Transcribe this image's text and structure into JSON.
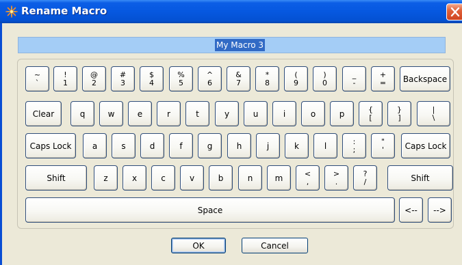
{
  "window": {
    "title": "Rename Macro",
    "icon": "asterisk-sparkle-icon",
    "close_icon": "close-x-icon"
  },
  "name_field": {
    "value": "My Macro 3"
  },
  "keyboard": {
    "rows": [
      [
        {
          "id": "tilde",
          "top": "~",
          "bottom": "`"
        },
        {
          "id": "1",
          "top": "!",
          "bottom": "1"
        },
        {
          "id": "2",
          "top": "@",
          "bottom": "2"
        },
        {
          "id": "3",
          "top": "#",
          "bottom": "3"
        },
        {
          "id": "4",
          "top": "$",
          "bottom": "4"
        },
        {
          "id": "5",
          "top": "%",
          "bottom": "5"
        },
        {
          "id": "6",
          "top": "^",
          "bottom": "6"
        },
        {
          "id": "7",
          "top": "&",
          "bottom": "7"
        },
        {
          "id": "8",
          "top": "*",
          "bottom": "8"
        },
        {
          "id": "9",
          "top": "(",
          "bottom": "9"
        },
        {
          "id": "0",
          "top": ")",
          "bottom": "0"
        },
        {
          "id": "minus",
          "top": "_",
          "bottom": "-"
        },
        {
          "id": "equals",
          "top": "+",
          "bottom": "="
        },
        {
          "id": "backspace",
          "label": "Backspace"
        }
      ],
      [
        {
          "id": "clear",
          "label": "Clear"
        },
        {
          "id": "q",
          "label": "q"
        },
        {
          "id": "w",
          "label": "w"
        },
        {
          "id": "e",
          "label": "e"
        },
        {
          "id": "r",
          "label": "r"
        },
        {
          "id": "t",
          "label": "t"
        },
        {
          "id": "y",
          "label": "y"
        },
        {
          "id": "u",
          "label": "u"
        },
        {
          "id": "i",
          "label": "i"
        },
        {
          "id": "o",
          "label": "o"
        },
        {
          "id": "p",
          "label": "p"
        },
        {
          "id": "lbracket",
          "top": "{",
          "bottom": "["
        },
        {
          "id": "rbracket",
          "top": "}",
          "bottom": "]"
        },
        {
          "id": "backslash",
          "top": "|",
          "bottom": "\\"
        }
      ],
      [
        {
          "id": "capslock-left",
          "label": "Caps Lock"
        },
        {
          "id": "a",
          "label": "a"
        },
        {
          "id": "s",
          "label": "s"
        },
        {
          "id": "d",
          "label": "d"
        },
        {
          "id": "f",
          "label": "f"
        },
        {
          "id": "g",
          "label": "g"
        },
        {
          "id": "h",
          "label": "h"
        },
        {
          "id": "j",
          "label": "j"
        },
        {
          "id": "k",
          "label": "k"
        },
        {
          "id": "l",
          "label": "l"
        },
        {
          "id": "semicolon",
          "top": ":",
          "bottom": ";"
        },
        {
          "id": "quote",
          "top": "\"",
          "bottom": "'"
        },
        {
          "id": "capslock-right",
          "label": "Caps Lock"
        }
      ],
      [
        {
          "id": "shift-left",
          "label": "Shift"
        },
        {
          "id": "z",
          "label": "z"
        },
        {
          "id": "x",
          "label": "x"
        },
        {
          "id": "c",
          "label": "c"
        },
        {
          "id": "v",
          "label": "v"
        },
        {
          "id": "b",
          "label": "b"
        },
        {
          "id": "n",
          "label": "n"
        },
        {
          "id": "m",
          "label": "m"
        },
        {
          "id": "comma",
          "top": "<",
          "bottom": ","
        },
        {
          "id": "period",
          "top": ">",
          "bottom": "."
        },
        {
          "id": "slash",
          "top": "?",
          "bottom": "/"
        },
        {
          "id": "shift-right",
          "label": "Shift"
        }
      ],
      [
        {
          "id": "space",
          "label": "Space"
        },
        {
          "id": "arrow-left",
          "label": "<--"
        },
        {
          "id": "arrow-right",
          "label": "-->"
        }
      ]
    ]
  },
  "buttons": {
    "ok": "OK",
    "cancel": "Cancel"
  }
}
